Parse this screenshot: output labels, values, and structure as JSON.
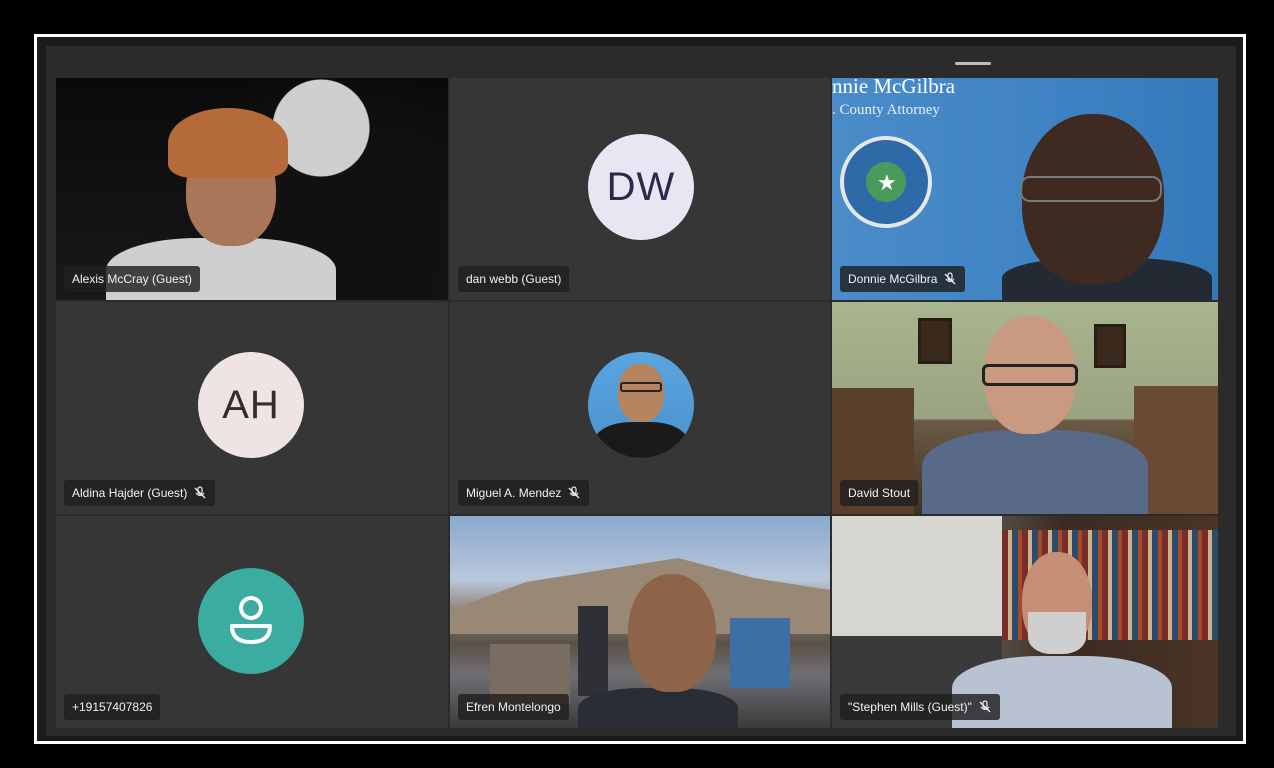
{
  "meeting": {
    "participants": [
      {
        "name": "Alexis McCray (Guest)",
        "muted": false
      },
      {
        "name": "dan webb (Guest)",
        "initials": "DW",
        "muted": false
      },
      {
        "name": "Donnie McGilbra",
        "muted": true,
        "background_text": [
          "nnie McGilbra",
          ". County Attorney"
        ]
      },
      {
        "name": "Aldina Hajder (Guest)",
        "initials": "AH",
        "muted": true
      },
      {
        "name": "Miguel A. Mendez",
        "muted": true
      },
      {
        "name": "David Stout",
        "muted": false
      },
      {
        "name": "+19157407826",
        "muted": false
      },
      {
        "name": "Efren Montelongo",
        "muted": false
      },
      {
        "name": "\"Stephen Mills (Guest)\"",
        "muted": true
      }
    ]
  },
  "colors": {
    "tile_bg": "#363636",
    "label_bg": "#202020",
    "avatar_dw": "#e8e6f3",
    "avatar_ah": "#efe4e4",
    "avatar_phone": "#3aaca0"
  },
  "icons": {
    "muted": "mic-off-icon",
    "phone_user": "person-icon"
  }
}
